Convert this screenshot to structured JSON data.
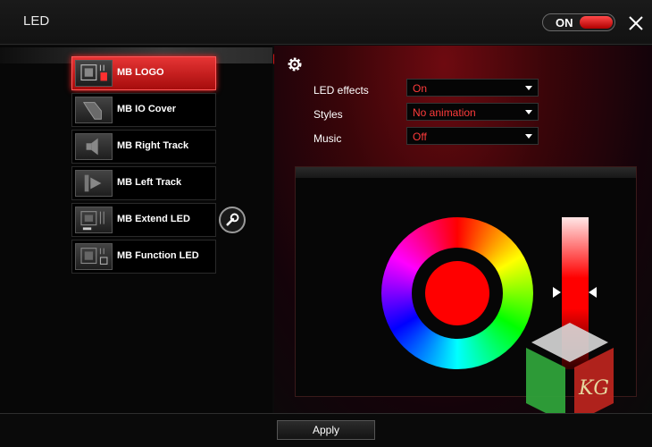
{
  "window": {
    "title": "LED"
  },
  "power_toggle": {
    "label": "ON",
    "state": "on"
  },
  "devices": [
    {
      "label": "MB LOGO",
      "icon": "chip-icon",
      "active": true
    },
    {
      "label": "MB IO Cover",
      "icon": "io-cover-icon",
      "active": false
    },
    {
      "label": "MB Right Track",
      "icon": "right-track-icon",
      "active": false
    },
    {
      "label": "MB Left Track",
      "icon": "left-track-icon",
      "active": false
    },
    {
      "label": "MB Extend LED",
      "icon": "extend-led-icon",
      "active": false
    },
    {
      "label": "MB Function LED",
      "icon": "function-led-icon",
      "active": false
    }
  ],
  "settings": {
    "led_effects": {
      "label": "LED effects",
      "value": "On"
    },
    "styles": {
      "label": "Styles",
      "value": "No animation"
    },
    "music": {
      "label": "Music",
      "value": "Off"
    }
  },
  "color": {
    "selected": "#ff0000",
    "brightness_percent": 50
  },
  "watermark": {
    "text": "KG"
  },
  "apply": {
    "label": "Apply"
  },
  "colors": {
    "accent": "#d01818",
    "selected_value": "#ff3b3b",
    "background": "#0b0b0b"
  }
}
